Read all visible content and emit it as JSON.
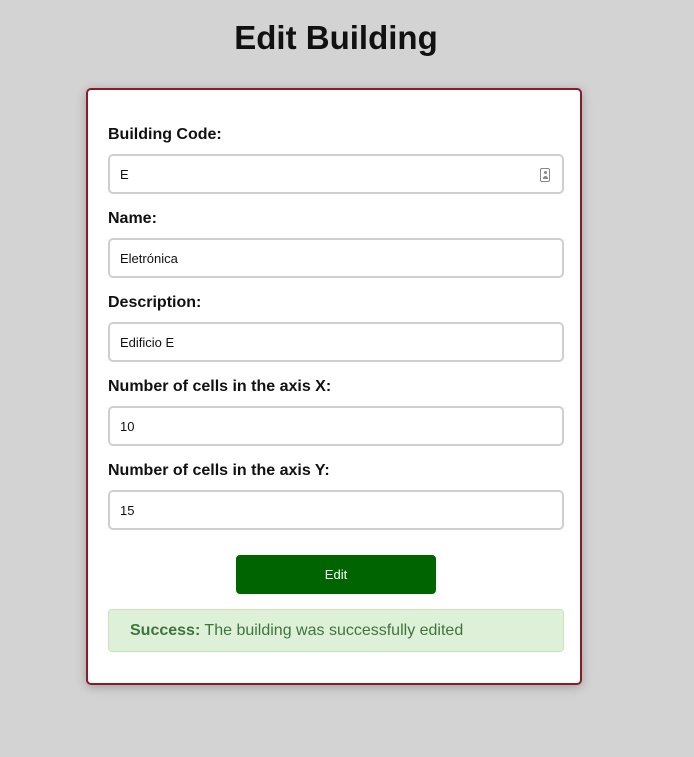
{
  "page": {
    "title": "Edit Building"
  },
  "form": {
    "fields": [
      {
        "label": "Building Code:",
        "value": "E"
      },
      {
        "label": "Name:",
        "value": "Eletrónica"
      },
      {
        "label": "Description:",
        "value": "Edificio E"
      },
      {
        "label": "Number of cells in the axis X:",
        "value": "10"
      },
      {
        "label": "Number of cells in the axis Y:",
        "value": "15"
      }
    ],
    "submit_label": "Edit"
  },
  "alert": {
    "title": "Success:",
    "message": " The building was successfully edited"
  },
  "colors": {
    "background": "#d3d3d3",
    "card_border": "#8b1a2b",
    "button": "#006400",
    "alert_bg": "#dff0d8",
    "alert_text": "#3c763d"
  },
  "icons": {
    "autofill": "contact-card-icon"
  }
}
